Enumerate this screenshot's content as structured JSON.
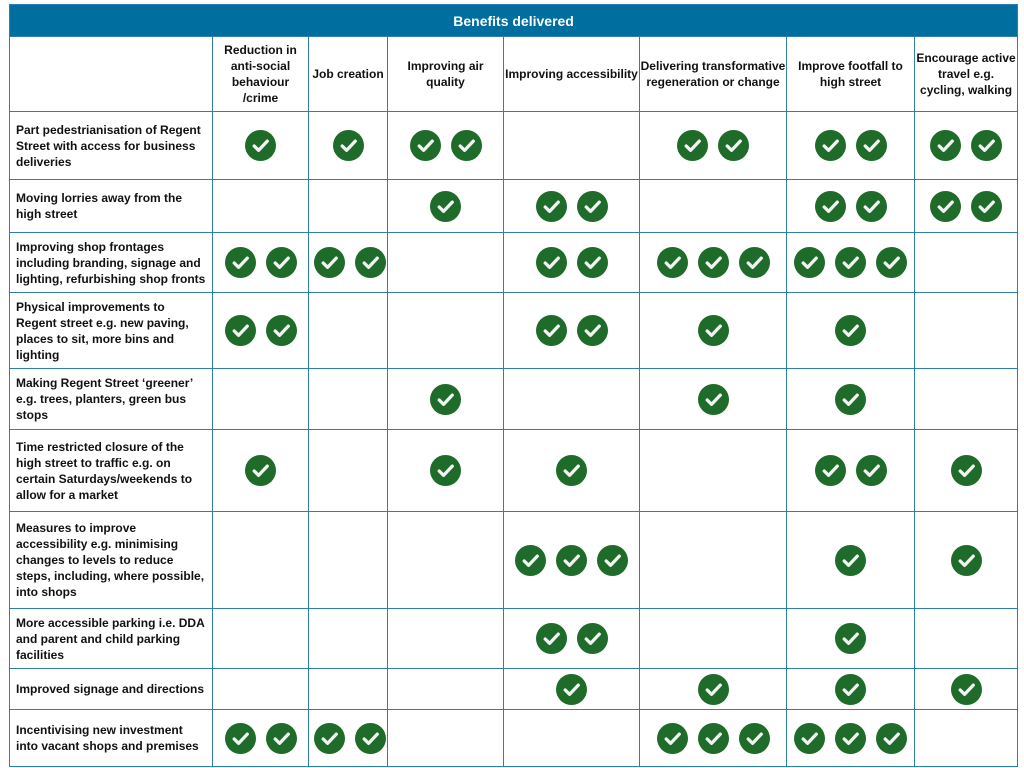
{
  "table": {
    "title": "Benefits delivered",
    "columns": [
      "Reduction in anti-social behaviour /crime",
      "Job creation",
      "Improving air quality",
      "Improving accessibility",
      "Delivering transformative regeneration or change",
      "Improve footfall to high street",
      "Encourage active travel e.g. cycling, walking"
    ],
    "rows": [
      {
        "label": "Part pedestrianisation of Regent Street with access for business deliveries",
        "checks": [
          1,
          1,
          2,
          0,
          2,
          2,
          2
        ]
      },
      {
        "label": "Moving lorries away from the high street",
        "checks": [
          0,
          0,
          1,
          2,
          0,
          2,
          2
        ]
      },
      {
        "label": "Improving shop frontages including branding, signage and lighting, refurbishing shop fronts",
        "checks": [
          2,
          2,
          0,
          2,
          3,
          3,
          0
        ]
      },
      {
        "label": "Physical improvements to Regent street e.g. new paving, places to sit, more bins and lighting",
        "checks": [
          2,
          0,
          0,
          2,
          1,
          1,
          0
        ]
      },
      {
        "label": "Making Regent Street ‘greener’ e.g. trees, planters, green bus stops",
        "checks": [
          0,
          0,
          1,
          0,
          1,
          1,
          0
        ]
      },
      {
        "label": "Time restricted closure of the high street to traffic e.g. on certain Saturdays/weekends to allow for a market",
        "checks": [
          1,
          0,
          1,
          1,
          0,
          2,
          1
        ]
      },
      {
        "label": "Measures to improve accessibility e.g. minimising changes to levels to reduce steps, including, where possible, into shops",
        "checks": [
          0,
          0,
          0,
          3,
          0,
          1,
          1
        ]
      },
      {
        "label": "More accessible parking i.e. DDA and parent and child parking facilities",
        "checks": [
          0,
          0,
          0,
          2,
          0,
          1,
          0
        ]
      },
      {
        "label": "Improved signage and directions",
        "checks": [
          0,
          0,
          0,
          1,
          1,
          1,
          1
        ]
      },
      {
        "label": "Incentivising new investment into vacant shops and premises",
        "checks": [
          2,
          2,
          0,
          0,
          3,
          3,
          0
        ]
      }
    ],
    "icon": "check-circle-icon",
    "colors": {
      "header_bg": "#006e9e",
      "check": "#1e6b2a",
      "border": "#2e7fb0"
    }
  }
}
